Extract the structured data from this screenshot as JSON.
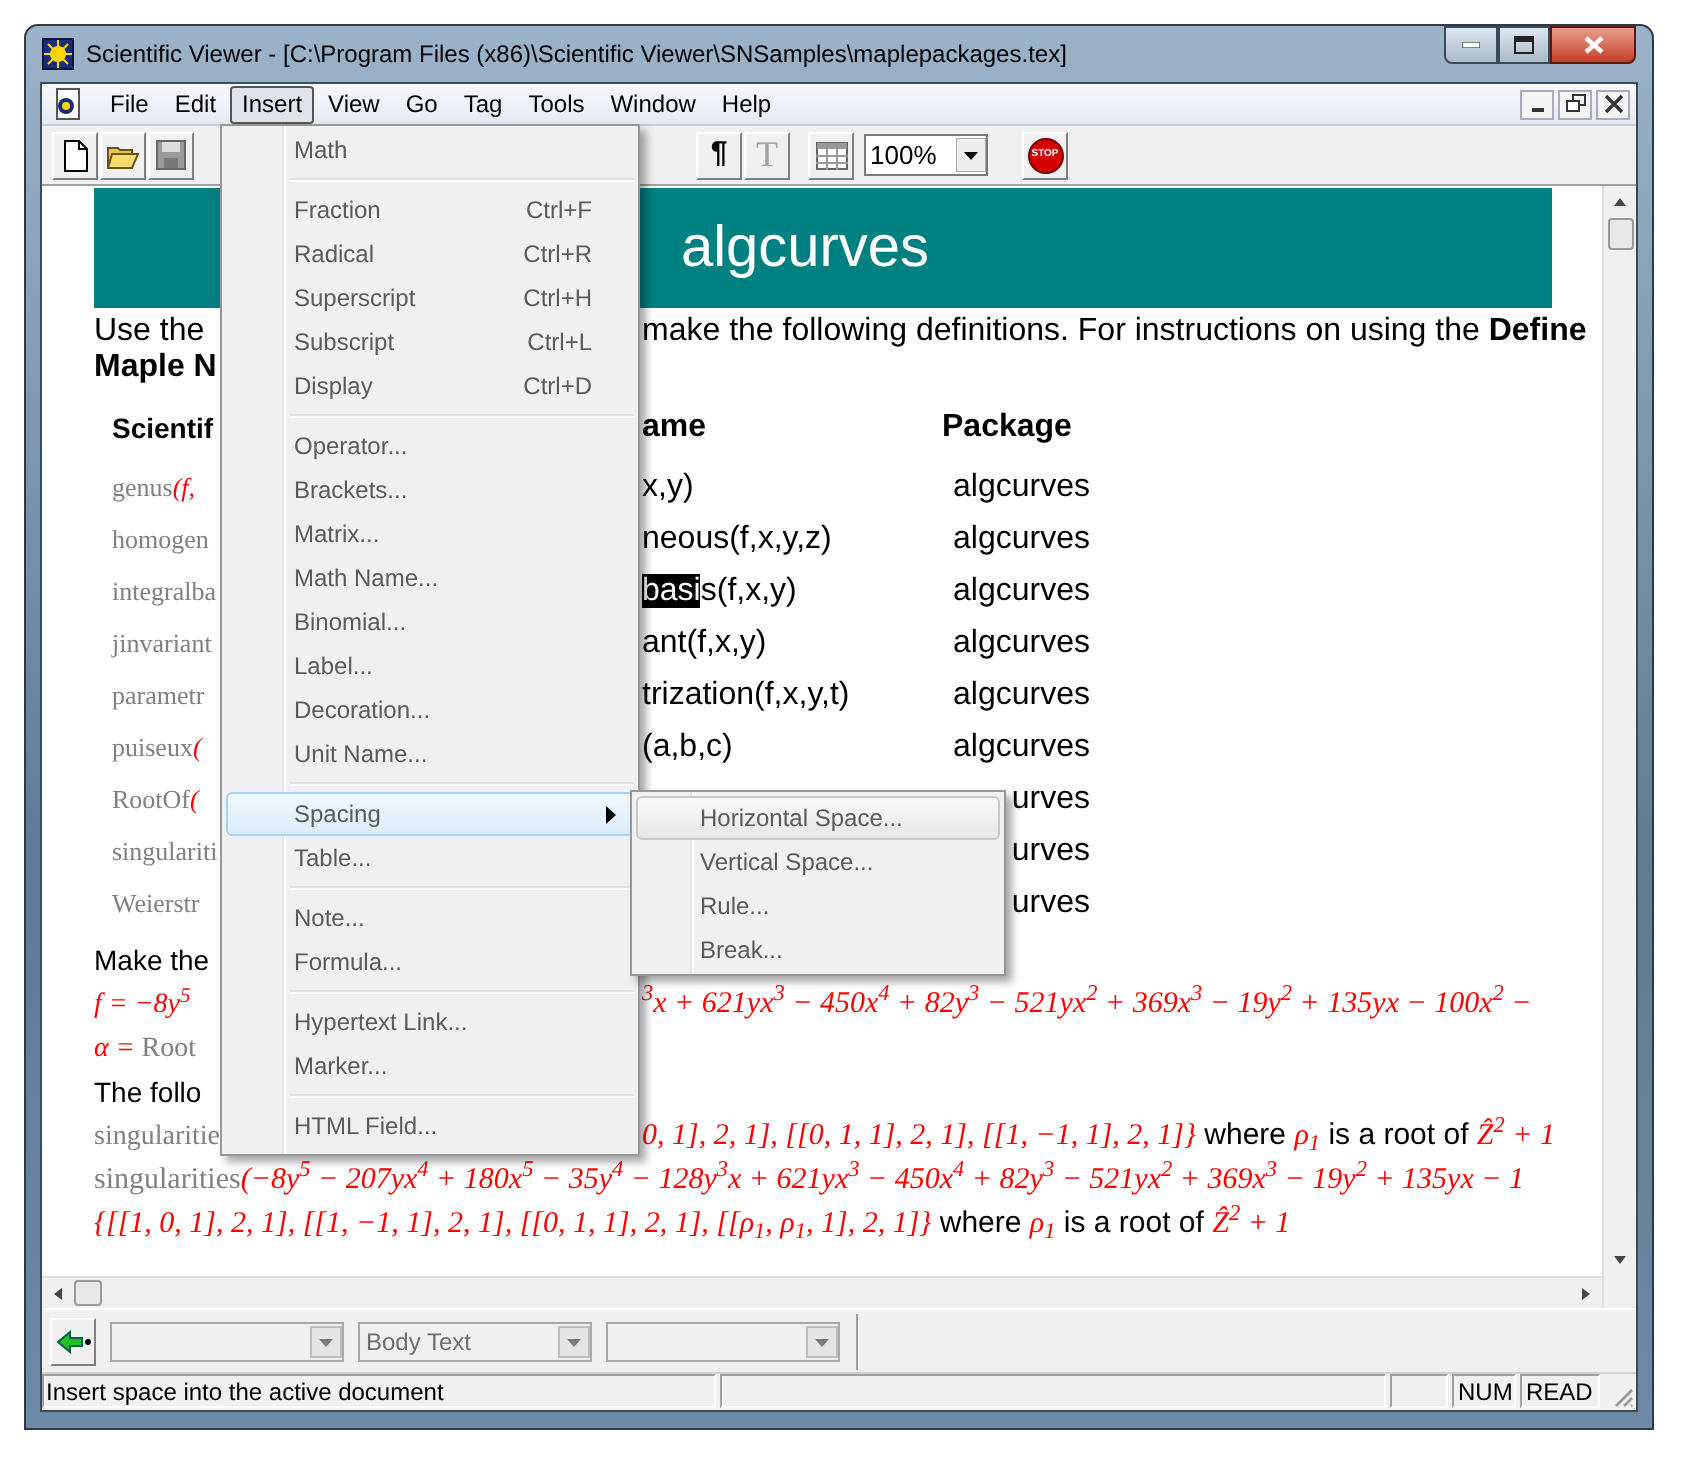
{
  "window": {
    "title": "Scientific Viewer - [C:\\Program Files (x86)\\Scientific Viewer\\SNSamples\\maplepackages.tex]"
  },
  "menubar": [
    {
      "label": "File",
      "selected": false
    },
    {
      "label": "Edit",
      "selected": false
    },
    {
      "label": "Insert",
      "selected": true
    },
    {
      "label": "View",
      "selected": false
    },
    {
      "label": "Go",
      "selected": false
    },
    {
      "label": "Tag",
      "selected": false
    },
    {
      "label": "Tools",
      "selected": false
    },
    {
      "label": "Window",
      "selected": false
    },
    {
      "label": "Help",
      "selected": false
    }
  ],
  "toolbar": {
    "pilcrow": "¶",
    "text_tool": "T",
    "zoom": "100%",
    "stop": "STOP"
  },
  "insert_menu": {
    "groups": [
      [
        {
          "label": "Math",
          "selected": false,
          "has_submenu": false
        }
      ],
      [
        {
          "label": "Fraction",
          "shortcut": "Ctrl+F",
          "selected": false,
          "has_submenu": false
        },
        {
          "label": "Radical",
          "shortcut": "Ctrl+R",
          "selected": false,
          "has_submenu": false
        },
        {
          "label": "Superscript",
          "shortcut": "Ctrl+H",
          "selected": false,
          "has_submenu": false
        },
        {
          "label": "Subscript",
          "shortcut": "Ctrl+L",
          "selected": false,
          "has_submenu": false
        },
        {
          "label": "Display",
          "shortcut": "Ctrl+D",
          "selected": false,
          "has_submenu": false
        }
      ],
      [
        {
          "label": "Operator...",
          "selected": false,
          "has_submenu": false
        },
        {
          "label": "Brackets...",
          "selected": false,
          "has_submenu": false
        },
        {
          "label": "Matrix...",
          "selected": false,
          "has_submenu": false
        },
        {
          "label": "Math Name...",
          "selected": false,
          "has_submenu": false
        },
        {
          "label": "Binomial...",
          "selected": false,
          "has_submenu": false
        },
        {
          "label": "Label...",
          "selected": false,
          "has_submenu": false
        },
        {
          "label": "Decoration...",
          "selected": false,
          "has_submenu": false
        },
        {
          "label": "Unit Name...",
          "selected": false,
          "has_submenu": false
        }
      ],
      [
        {
          "label": "Spacing",
          "selected": true,
          "has_submenu": true
        },
        {
          "label": "Table...",
          "selected": false,
          "has_submenu": false
        }
      ],
      [
        {
          "label": "Note...",
          "selected": false,
          "has_submenu": false
        },
        {
          "label": "Formula...",
          "selected": false,
          "has_submenu": false
        }
      ],
      [
        {
          "label": "Hypertext Link...",
          "selected": false,
          "has_submenu": false
        },
        {
          "label": "Marker...",
          "selected": false,
          "has_submenu": false
        }
      ],
      [
        {
          "label": "HTML Field...",
          "selected": false,
          "has_submenu": false
        }
      ]
    ]
  },
  "spacing_submenu": [
    {
      "label": "Horizontal Space...",
      "selected": true
    },
    {
      "label": "Vertical Space...",
      "selected": false
    },
    {
      "label": "Rule...",
      "selected": false
    },
    {
      "label": "Break...",
      "selected": false
    }
  ],
  "document": {
    "heading": "algcurves",
    "intro": [
      {
        "left": "Use the",
        "right": "make the following definitions. For instructions on using the **Define**"
      },
      {
        "left": "**Maple N**"
      }
    ],
    "table": {
      "headers": {
        "left": "Scientif",
        "name": "ame",
        "package": "Package"
      },
      "rows": [
        {
          "left": [
            {
              "kind": "name",
              "text": "genus"
            },
            {
              "kind": "math",
              "text": "(f,"
            }
          ],
          "name": [
            {
              "text": "x,y)",
              "selected": false
            }
          ],
          "package": "algcurves"
        },
        {
          "left": [
            {
              "kind": "name",
              "text": "homogen"
            }
          ],
          "name": [
            {
              "text": "neous(f,x,y,z)",
              "selected": false
            }
          ],
          "package": "algcurves"
        },
        {
          "left": [
            {
              "kind": "name",
              "text": "integralba"
            }
          ],
          "name": [
            {
              "text": "basi",
              "selected": true
            },
            {
              "text": "s(f,x,y)",
              "selected": false
            }
          ],
          "package": "algcurves"
        },
        {
          "left": [
            {
              "kind": "name",
              "text": "jinvariant"
            }
          ],
          "name": [
            {
              "text": "ant(f,x,y)",
              "selected": false
            }
          ],
          "package": "algcurves"
        },
        {
          "left": [
            {
              "kind": "name",
              "text": "parametr"
            }
          ],
          "name": [
            {
              "text": "trization(f,x,y,t)",
              "selected": false
            }
          ],
          "package": "algcurves"
        },
        {
          "left": [
            {
              "kind": "name",
              "text": "puiseux"
            },
            {
              "kind": "math",
              "text": "("
            }
          ],
          "name": [
            {
              "text": "(a,b,c)",
              "selected": false
            }
          ],
          "package": "algcurves"
        },
        {
          "left": [
            {
              "kind": "name",
              "text": "RootOf"
            },
            {
              "kind": "math",
              "text": "("
            }
          ],
          "name": [],
          "package": "urves"
        },
        {
          "left": [
            {
              "kind": "name",
              "text": "singulariti"
            }
          ],
          "name": [],
          "package": "urves"
        },
        {
          "left": [
            {
              "kind": "name",
              "text": "Weierstr"
            }
          ],
          "name": [],
          "package": "urves"
        }
      ]
    },
    "lines": [
      {
        "left": [
          {
            "kind": "text",
            "text": "Make the"
          }
        ]
      },
      {
        "left": [
          {
            "kind": "math",
            "text": "f = −8y$^{5}$"
          }
        ],
        "right": [
          {
            "kind": "math",
            "text": "$^{3}$x + 621yx$^{3}$ − 450x$^{4}$ + 82y$^{3}$ − 521yx$^{2}$ + 369x$^{3}$ − 19y$^{2}$ + 135yx − 100x$^{2}$ −"
          }
        ]
      },
      {
        "left": [
          {
            "kind": "math",
            "text": "α ="
          },
          {
            "kind": "name",
            "text": " Root"
          }
        ]
      },
      {
        "left": [
          {
            "kind": "text",
            "text": "The follo"
          }
        ]
      },
      {
        "left": [
          {
            "kind": "name",
            "text": "singularitie"
          }
        ],
        "right": [
          {
            "kind": "math",
            "text": "0, 1], 2, 1], [[0, 1, 1], 2, 1], [[1, −1, 1], 2, 1]}"
          },
          {
            "kind": "text",
            "text": " where "
          },
          {
            "kind": "math",
            "text": "ρ$_{1}$"
          },
          {
            "kind": "text",
            "text": " is a root of "
          },
          {
            "kind": "math",
            "text": "Ẑ$^{2}$ + 1"
          }
        ]
      }
    ],
    "full_lines": [
      [
        {
          "kind": "name",
          "text": "singularities"
        },
        {
          "kind": "math",
          "text": "(−8y$^{5}$ − 207yx$^{4}$ + 180x$^{5}$ − 35y$^{4}$ − 128y$^{3}$x + 621yx$^{3}$ − 450x$^{4}$ + 82y$^{3}$ − 521yx$^{2}$ + 369x$^{3}$ − 19y$^{2}$ + 135yx − 1"
        }
      ],
      [
        {
          "kind": "math",
          "text": "{[[1, 0, 1], 2, 1], [[1, −1, 1], 2, 1], [[0, 1, 1], 2, 1], [[ρ$_{1}$, ρ$_{1}$, 1], 2, 1]}"
        },
        {
          "kind": "text",
          "text": " where "
        },
        {
          "kind": "math",
          "text": "ρ$_{1}$"
        },
        {
          "kind": "text",
          "text": " is a root of "
        },
        {
          "kind": "math",
          "text": "Ẑ$^{2}$ + 1"
        }
      ]
    ]
  },
  "format_bar": {
    "style": "Body Text"
  },
  "status_bar": {
    "message": "Insert space into the active document",
    "num": "NUM",
    "mode": "READ"
  }
}
